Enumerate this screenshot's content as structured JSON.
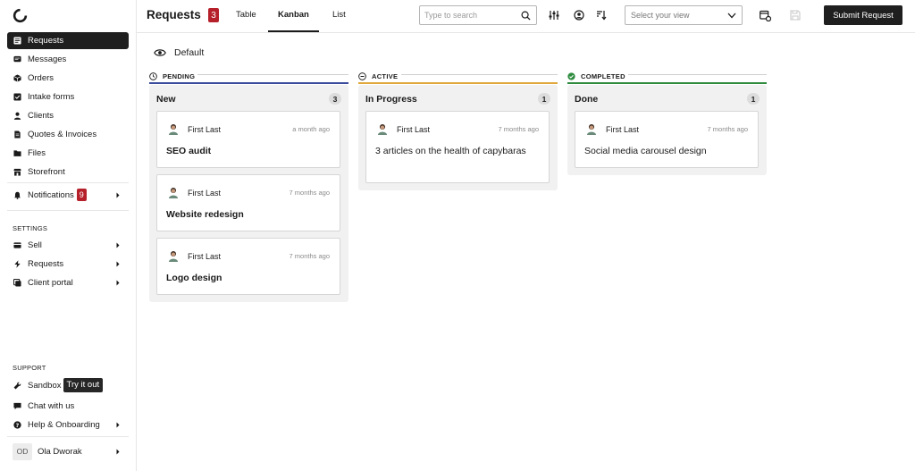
{
  "sidebar": {
    "logo": "logo-ring-icon",
    "items": [
      {
        "label": "Requests",
        "icon": "list-icon",
        "active": true
      },
      {
        "label": "Messages",
        "icon": "chat-bubble-icon"
      },
      {
        "label": "Orders",
        "icon": "box-icon"
      },
      {
        "label": "Intake forms",
        "icon": "checkbox-icon"
      },
      {
        "label": "Clients",
        "icon": "person-icon"
      },
      {
        "label": "Quotes & Invoices",
        "icon": "document-icon"
      },
      {
        "label": "Files",
        "icon": "folder-icon"
      },
      {
        "label": "Storefront",
        "icon": "store-icon"
      }
    ],
    "notifications": {
      "label": "Notifications",
      "count": "9"
    },
    "settings_label": "SETTINGS",
    "settings_items": [
      {
        "label": "Sell",
        "icon": "card-icon"
      },
      {
        "label": "Requests",
        "icon": "bolt-icon"
      },
      {
        "label": "Client portal",
        "icon": "portal-icon"
      }
    ],
    "support_label": "SUPPORT",
    "support_items": [
      {
        "label": "Sandbox",
        "icon": "wrench-icon",
        "tag": "Try it out"
      },
      {
        "label": "Chat with us",
        "icon": "chat-icon"
      },
      {
        "label": "Help & Onboarding",
        "icon": "question-icon"
      }
    ],
    "user": {
      "initials": "OD",
      "name": "Ola Dworak"
    }
  },
  "header": {
    "title": "Requests",
    "count": "3",
    "tabs": [
      {
        "label": "Table"
      },
      {
        "label": "Kanban",
        "active": true
      },
      {
        "label": "List"
      }
    ],
    "search_placeholder": "Type to search",
    "view_placeholder": "Select your view",
    "submit_label": "Submit Request"
  },
  "view": {
    "label": "Default"
  },
  "columns": [
    {
      "status": "PENDING",
      "color": "#3b4a9c",
      "title": "New",
      "count": "3",
      "cards": [
        {
          "author": "First Last",
          "time": "a month ago",
          "title": "SEO audit"
        },
        {
          "author": "First Last",
          "time": "7 months ago",
          "title": "Website redesign"
        },
        {
          "author": "First Last",
          "time": "7 months ago",
          "title": "Logo design"
        }
      ]
    },
    {
      "status": "ACTIVE",
      "color": "#e0a83a",
      "title": "In Progress",
      "count": "1",
      "cards": [
        {
          "author": "First Last",
          "time": "7 months ago",
          "title": "3 articles on the health of capybaras"
        }
      ]
    },
    {
      "status": "COMPLETED",
      "color": "#2e8b3e",
      "title": "Done",
      "count": "1",
      "cards": [
        {
          "author": "First Last",
          "time": "7 months ago",
          "title": "Social media carousel design"
        }
      ]
    }
  ]
}
